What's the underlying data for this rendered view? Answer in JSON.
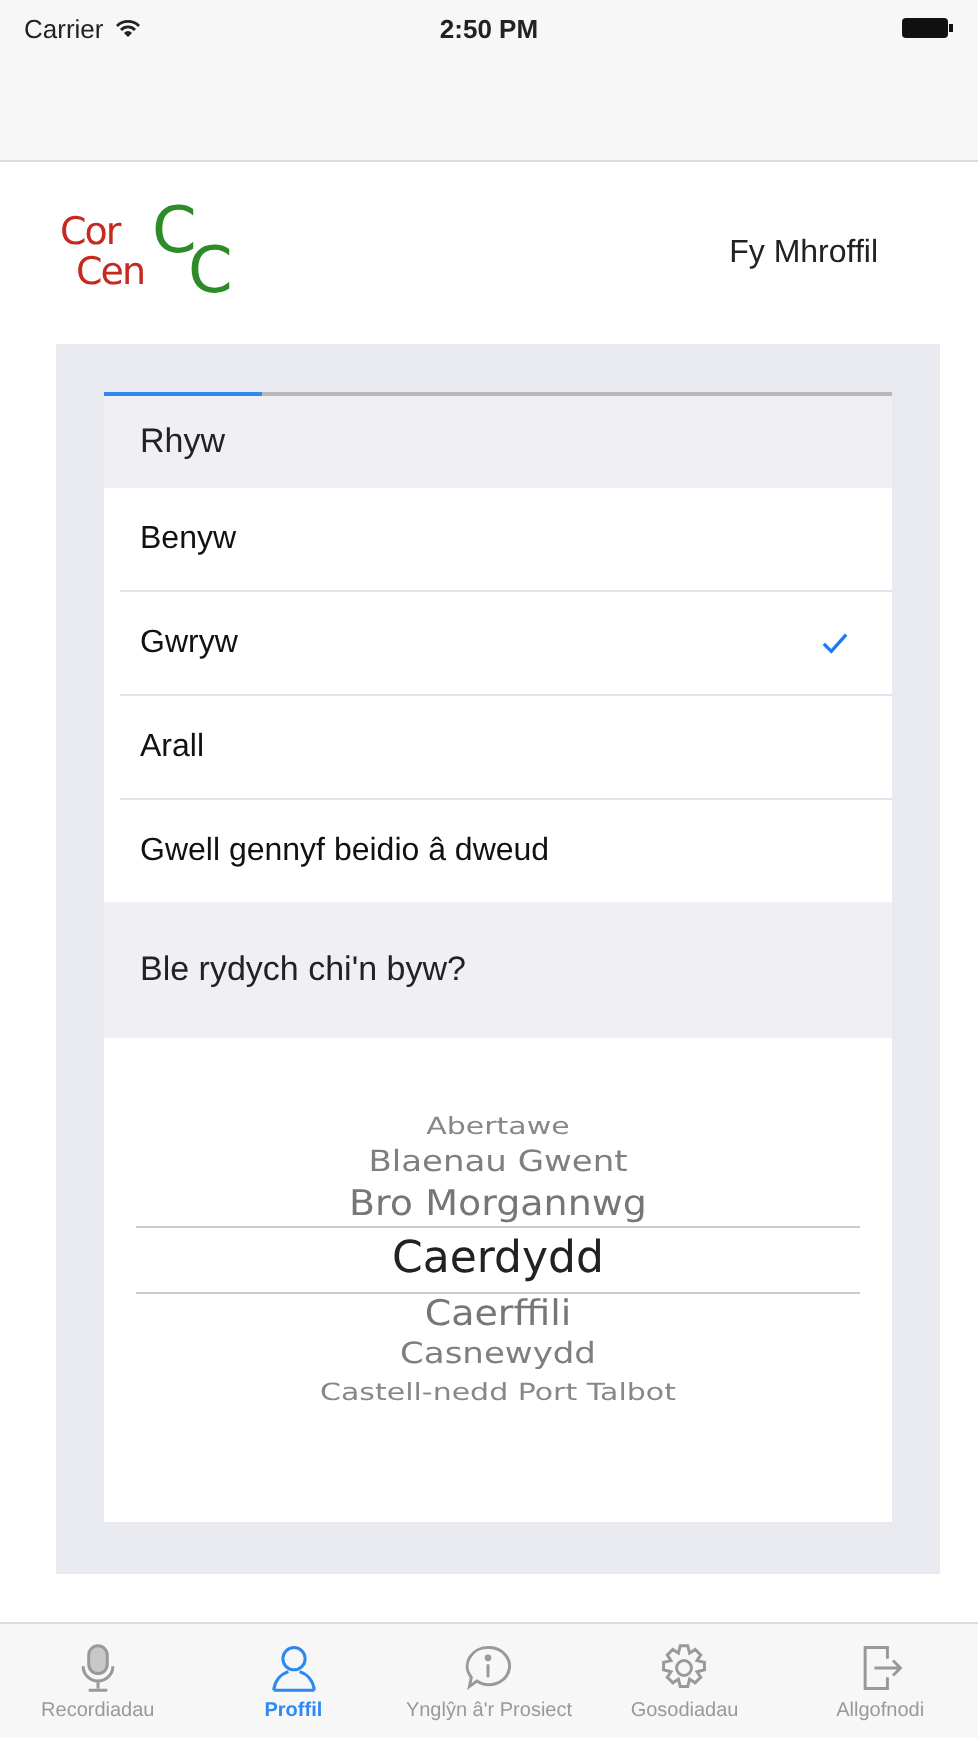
{
  "status_bar": {
    "carrier": "Carrier",
    "time": "2:50 PM"
  },
  "header": {
    "logo": [
      "Cor",
      "Cen",
      "C",
      "C"
    ],
    "title": "Fy Mhroffil"
  },
  "progress": {
    "level": 0.2
  },
  "gender": {
    "heading": "Rhyw",
    "options": [
      {
        "label": "Benyw",
        "selected": false
      },
      {
        "label": "Gwryw",
        "selected": true
      },
      {
        "label": "Arall",
        "selected": false
      },
      {
        "label": "Gwell gennyf beidio â dweud",
        "selected": false
      }
    ]
  },
  "location": {
    "heading": "Ble rydych chi'n byw?",
    "picker": [
      {
        "label": "Abertawe",
        "selected": false
      },
      {
        "label": "Blaenau Gwent",
        "selected": false
      },
      {
        "label": "Bro Morgannwg",
        "selected": false
      },
      {
        "label": "Caerdydd",
        "selected": true
      },
      {
        "label": "Caerffili",
        "selected": false
      },
      {
        "label": "Casnewydd",
        "selected": false
      },
      {
        "label": "Castell-nedd Port Talbot",
        "selected": false
      }
    ]
  },
  "tabs": [
    {
      "label": "Recordiadau",
      "selected": false
    },
    {
      "label": "Proffil",
      "selected": true
    },
    {
      "label": "Ynglŷn â'r Prosiect",
      "selected": false
    },
    {
      "label": "Gosodiadau",
      "selected": false
    },
    {
      "label": "Allgofnodi",
      "selected": false
    }
  ]
}
